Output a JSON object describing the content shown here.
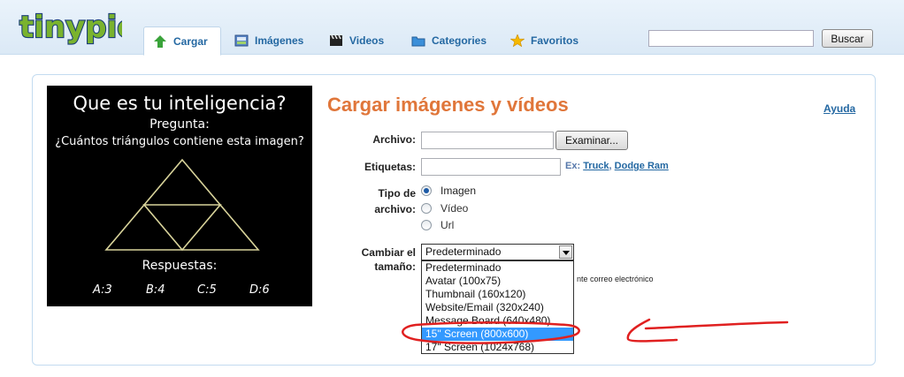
{
  "brand": {
    "logo_text": "tinypic",
    "color_logo_fill": "#7ab32e",
    "color_logo_outline": "#1b3e78"
  },
  "nav": {
    "tabs": [
      {
        "label": "Cargar",
        "icon": "up-arrow-icon",
        "active": true
      },
      {
        "label": "Imágenes",
        "icon": "images-icon",
        "active": false
      },
      {
        "label": "Videos",
        "icon": "clapperboard-icon",
        "active": false
      },
      {
        "label": "Categories",
        "icon": "folder-icon",
        "active": false
      },
      {
        "label": "Favoritos",
        "icon": "star-icon",
        "active": false
      }
    ],
    "search_value": "",
    "search_button": "Buscar"
  },
  "ad": {
    "title": "Que es tu inteligencia?",
    "subtitle": "Pregunta:",
    "question": "¿Cuántos triángulos contiene esta imagen?",
    "answers_label": "Respuestas:",
    "answers": [
      "A:3",
      "B:4",
      "C:5",
      "D:6"
    ]
  },
  "form": {
    "title": "Cargar imágenes y vídeos",
    "help_link": "Ayuda",
    "file_label": "Archivo:",
    "file_value": "",
    "browse_button": "Examinar...",
    "tags_label": "Etiquetas:",
    "tags_value": "",
    "tags_hint_prefix": "Ex: ",
    "tags_hint_example1": "Truck",
    "tags_hint_sep": ", ",
    "tags_hint_example2": "Dodge Ram",
    "type_label_line1": "Tipo de",
    "type_label_line2": "archivo:",
    "type_options": [
      {
        "label": "Imagen",
        "checked": true
      },
      {
        "label": "Vídeo",
        "checked": false
      },
      {
        "label": "Url",
        "checked": false
      }
    ],
    "resize_label_line1": "Cambiar el",
    "resize_label_line2": "tamaño:",
    "resize_selected": "Predeterminado",
    "resize_options": [
      "Predeterminado",
      "Avatar (100x75)",
      "Thumbnail (160x120)",
      "Website/Email (320x240)",
      "Message Board (640x480)",
      "15\" Screen (800x600)",
      "17\" Screen (1024x768)"
    ],
    "highlighted_option_index": 5,
    "partial_text_behind_dropdown": "nte correo electrónico"
  },
  "annotation": {
    "color": "#e02020",
    "description_shapes": [
      "ellipse-around-option",
      "arrow-pointing-left"
    ]
  }
}
